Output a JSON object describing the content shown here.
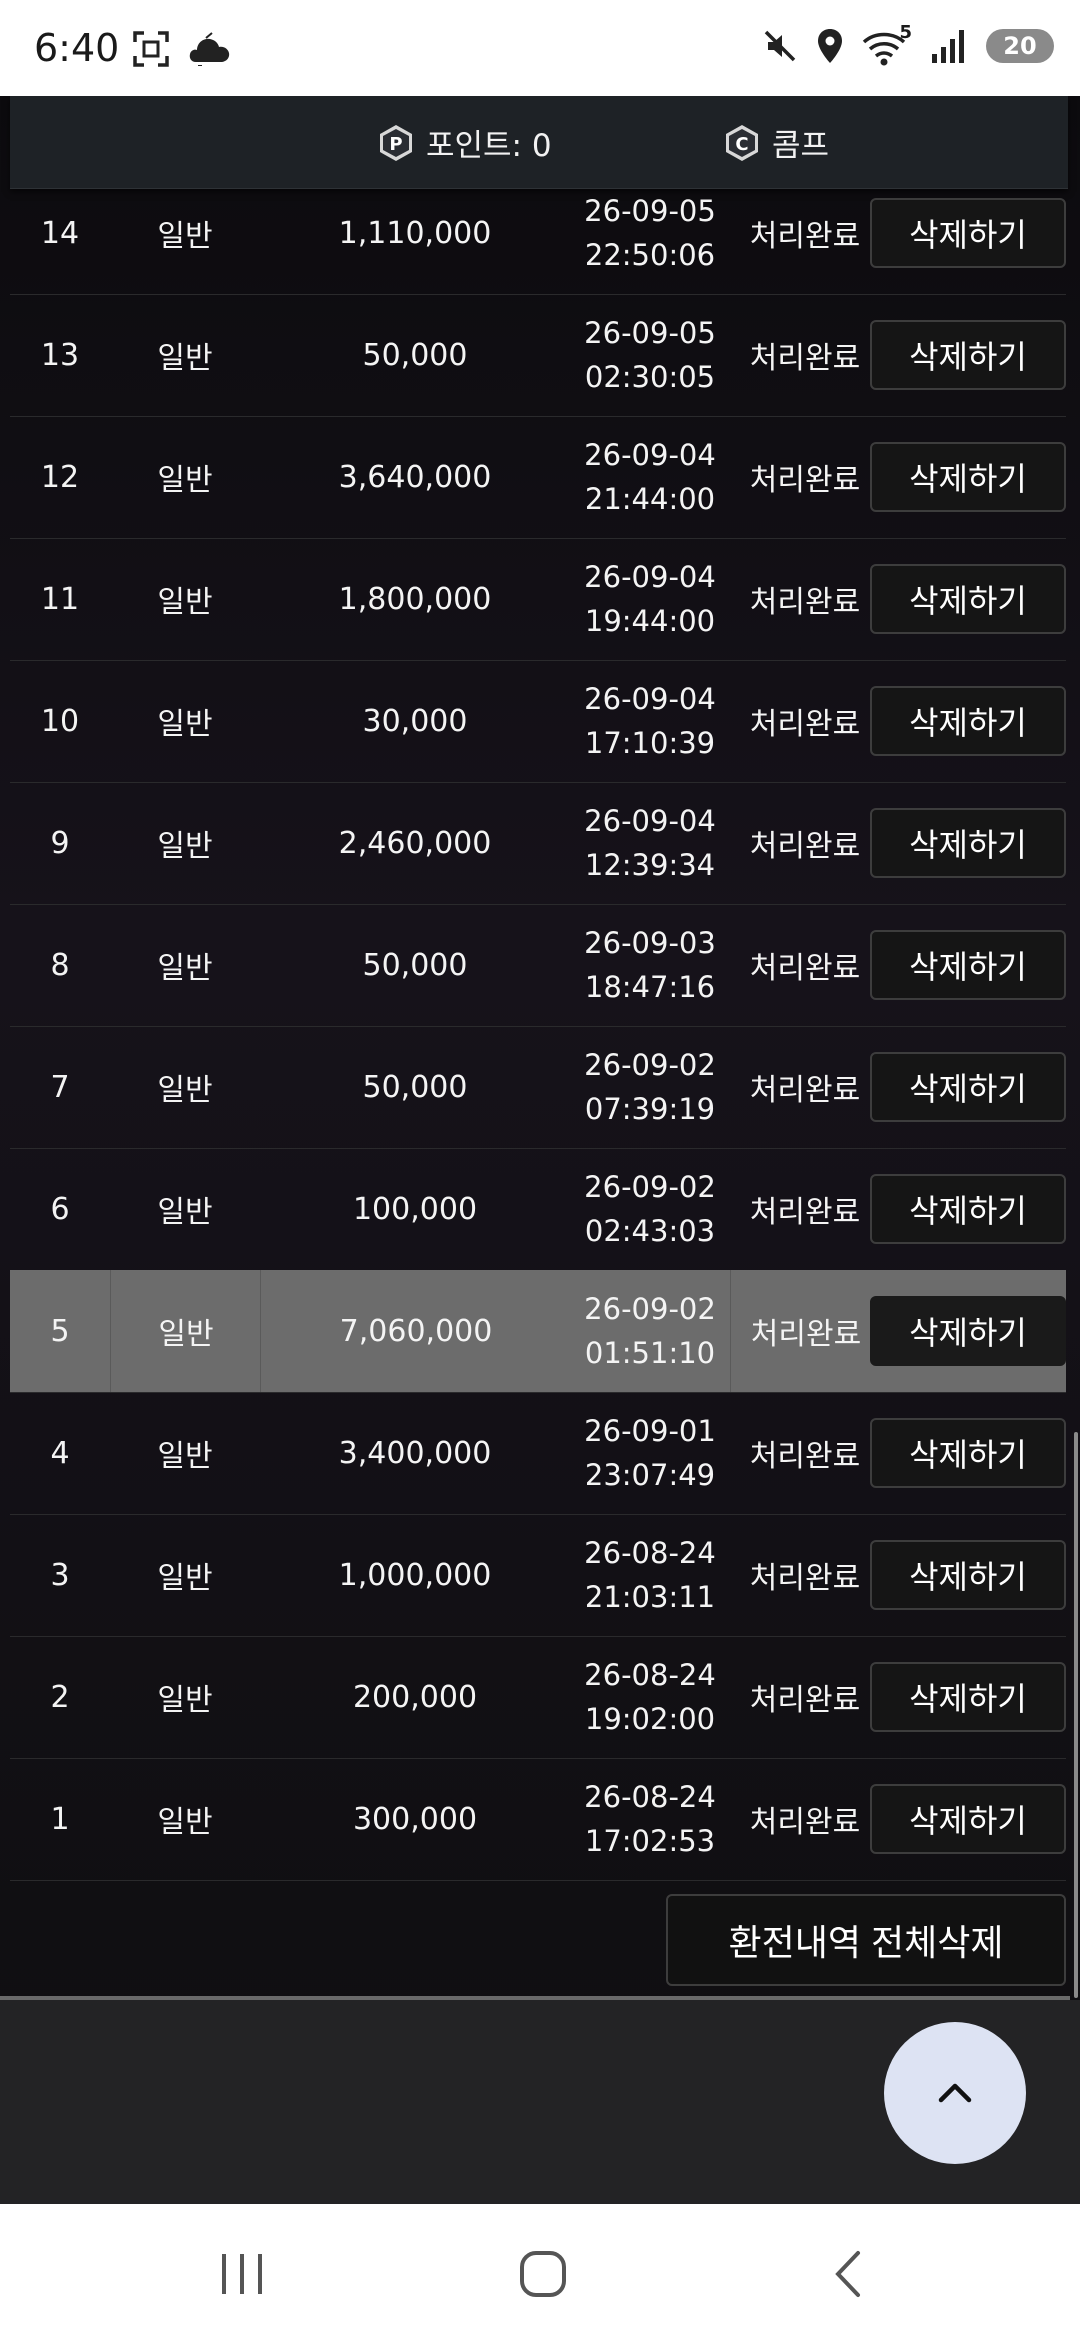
{
  "status_bar": {
    "time": "6:40",
    "wifi_badge": "5",
    "battery": "20"
  },
  "header": {
    "points_label": "포인트: 0",
    "comp_label": "콤프"
  },
  "rows": [
    {
      "no": "14",
      "type": "일반",
      "amount": "1,110,000",
      "date": "26-09-05",
      "time": "22:50:06",
      "status": "처리완료",
      "action": "삭제하기"
    },
    {
      "no": "13",
      "type": "일반",
      "amount": "50,000",
      "date": "26-09-05",
      "time": "02:30:05",
      "status": "처리완료",
      "action": "삭제하기"
    },
    {
      "no": "12",
      "type": "일반",
      "amount": "3,640,000",
      "date": "26-09-04",
      "time": "21:44:00",
      "status": "처리완료",
      "action": "삭제하기"
    },
    {
      "no": "11",
      "type": "일반",
      "amount": "1,800,000",
      "date": "26-09-04",
      "time": "19:44:00",
      "status": "처리완료",
      "action": "삭제하기"
    },
    {
      "no": "10",
      "type": "일반",
      "amount": "30,000",
      "date": "26-09-04",
      "time": "17:10:39",
      "status": "처리완료",
      "action": "삭제하기"
    },
    {
      "no": "9",
      "type": "일반",
      "amount": "2,460,000",
      "date": "26-09-04",
      "time": "12:39:34",
      "status": "처리완료",
      "action": "삭제하기"
    },
    {
      "no": "8",
      "type": "일반",
      "amount": "50,000",
      "date": "26-09-03",
      "time": "18:47:16",
      "status": "처리완료",
      "action": "삭제하기"
    },
    {
      "no": "7",
      "type": "일반",
      "amount": "50,000",
      "date": "26-09-02",
      "time": "07:39:19",
      "status": "처리완료",
      "action": "삭제하기"
    },
    {
      "no": "6",
      "type": "일반",
      "amount": "100,000",
      "date": "26-09-02",
      "time": "02:43:03",
      "status": "처리완료",
      "action": "삭제하기"
    },
    {
      "no": "5",
      "type": "일반",
      "amount": "7,060,000",
      "date": "26-09-02",
      "time": "01:51:10",
      "status": "처리완료",
      "action": "삭제하기"
    },
    {
      "no": "4",
      "type": "일반",
      "amount": "3,400,000",
      "date": "26-09-01",
      "time": "23:07:49",
      "status": "처리완료",
      "action": "삭제하기"
    },
    {
      "no": "3",
      "type": "일반",
      "amount": "1,000,000",
      "date": "26-08-24",
      "time": "21:03:11",
      "status": "처리완료",
      "action": "삭제하기"
    },
    {
      "no": "2",
      "type": "일반",
      "amount": "200,000",
      "date": "26-08-24",
      "time": "19:02:00",
      "status": "처리완료",
      "action": "삭제하기"
    },
    {
      "no": "1",
      "type": "일반",
      "amount": "300,000",
      "date": "26-08-24",
      "time": "17:02:53",
      "status": "처리완료",
      "action": "삭제하기"
    }
  ],
  "delete_all_label": "환전내역 전체삭제",
  "icons": [
    "scan-icon",
    "cloud-icon",
    "mute-icon",
    "location-icon",
    "wifi-icon",
    "signal-icon",
    "point-icon",
    "comp-icon",
    "chevron-up-icon",
    "recents-icon",
    "home-icon",
    "back-icon"
  ]
}
